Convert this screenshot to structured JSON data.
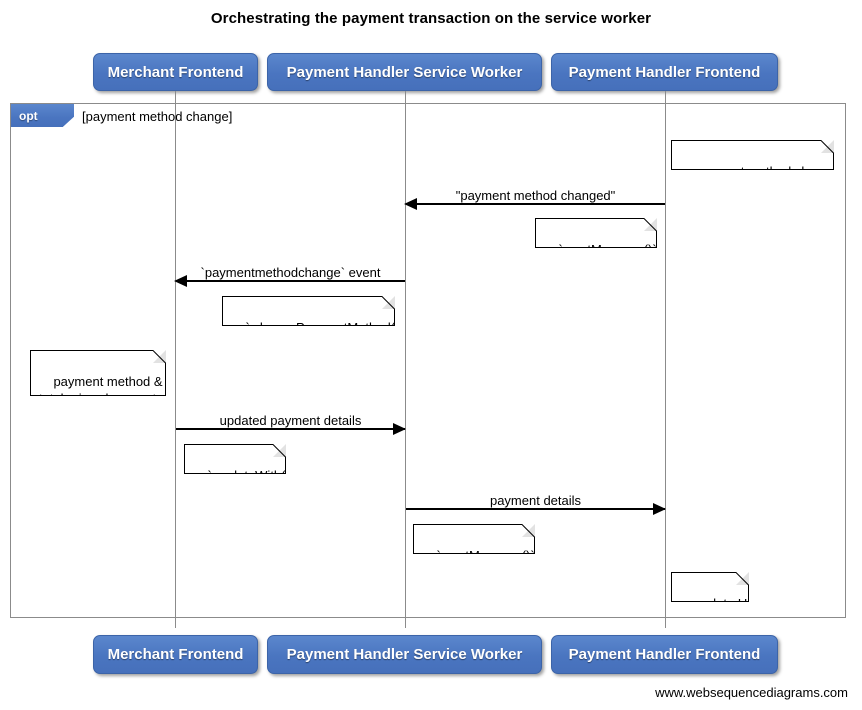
{
  "title": "Orchestrating the payment transaction on the service worker",
  "watermark": "www.websequencediagrams.com",
  "participants": [
    {
      "id": "merchant",
      "label": "Merchant Frontend"
    },
    {
      "id": "sw",
      "label": "Payment Handler Service Worker"
    },
    {
      "id": "phfrontend",
      "label": "Payment Handler Frontend"
    }
  ],
  "fragment": {
    "type": "opt",
    "tag": "opt",
    "condition": "[payment method change]"
  },
  "messages": [
    {
      "id": "m1",
      "label": "\"payment method changed\"",
      "from": "phfrontend",
      "to": "sw",
      "direction": "left"
    },
    {
      "id": "m2",
      "label": "`paymentmethodchange` event",
      "from": "sw",
      "to": "merchant",
      "direction": "left"
    },
    {
      "id": "m3",
      "label": "updated payment details",
      "from": "merchant",
      "to": "sw",
      "direction": "right"
    },
    {
      "id": "m4",
      "label": "payment details",
      "from": "sw",
      "to": "phfrontend",
      "direction": "right"
    }
  ],
  "notes": [
    {
      "id": "n1",
      "text": "payment method changed",
      "over": "phfrontend"
    },
    {
      "id": "n2",
      "text": "`.postMessage()`",
      "over": "phfrontend"
    },
    {
      "id": "n3",
      "text": "`.changePaymentMethod()`",
      "over": "sw"
    },
    {
      "id": "n4",
      "text": "payment method &\ntotal price change etc",
      "over": "merchant"
    },
    {
      "id": "n5",
      "text": "`.updateWith()`",
      "over": "merchant"
    },
    {
      "id": "n6",
      "text": "`.postMessage()`",
      "over": "sw"
    },
    {
      "id": "n7",
      "text": "update UI",
      "over": "phfrontend"
    }
  ],
  "colors": {
    "participant_fill": "#4d7cc7",
    "participant_border": "#3c64a8",
    "participant_text": "#ffffff",
    "lifeline": "#8b8b8b",
    "frame_border": "#8b8b8b",
    "message": "#000000",
    "note_fill": "#ffffff",
    "background": "#ffffff"
  }
}
